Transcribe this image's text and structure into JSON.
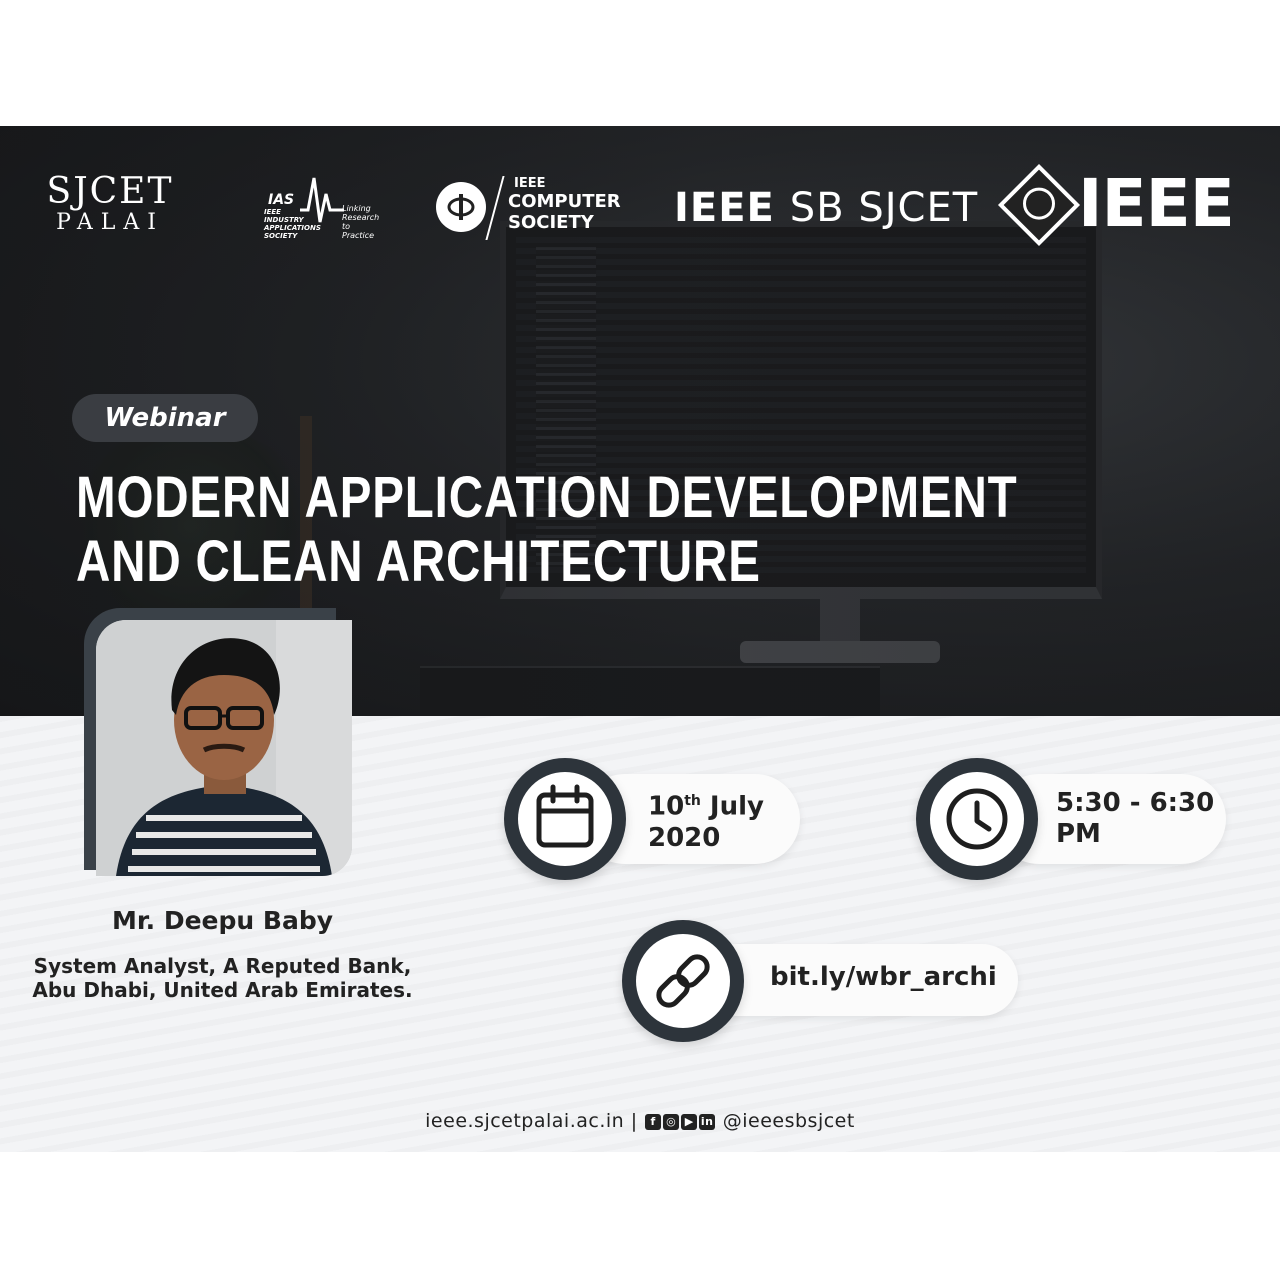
{
  "logos": {
    "sjcet_line1": "SJCET",
    "sjcet_line2": "PALAI",
    "ias_abbr": "IAS",
    "ias_name": "IEEE INDUSTRY APPLICATIONS SOCIETY",
    "ias_tagline": "Linking Research to Practice",
    "cs_line1": "IEEE",
    "cs_line2": "COMPUTER",
    "cs_line3": "SOCIETY",
    "sb_bold": "IEEE",
    "sb_rest": "SB SJCET",
    "ieee": "IEEE"
  },
  "event": {
    "type": "Webinar",
    "title_line1": "MODERN APPLICATION DEVELOPMENT",
    "title_line2": "AND CLEAN ARCHITECTURE"
  },
  "speaker": {
    "name": "Mr. Deepu Baby",
    "role_line1": "System Analyst, A Reputed Bank,",
    "role_line2": "Abu Dhabi, United Arab Emirates."
  },
  "details": {
    "date_day": "10",
    "date_suffix": "th",
    "date_month": "July",
    "date_year": "2020",
    "time_line1": "5:30 - 6:30",
    "time_line2": "PM",
    "link": "bit.ly/wbr_archi"
  },
  "icons": {
    "date": "calendar-icon",
    "time": "clock-icon",
    "link": "link-icon",
    "social": [
      "facebook-icon",
      "instagram-icon",
      "youtube-icon",
      "linkedin-icon"
    ]
  },
  "footer": {
    "website": "ieee.sjcetpalai.ac.in",
    "separator": "|",
    "handle": "@ieeesbsjcet"
  },
  "colors": {
    "dark": "#2d343b",
    "text": "#222222",
    "white": "#ffffff"
  }
}
